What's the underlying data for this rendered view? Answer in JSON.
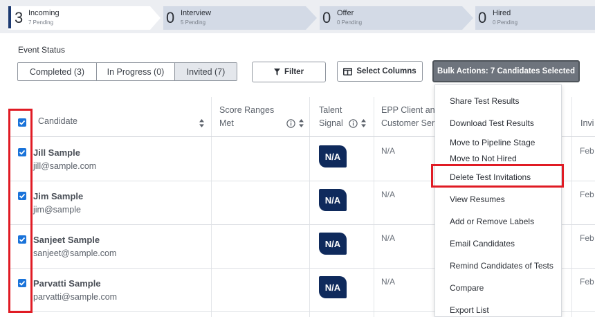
{
  "pipeline": {
    "stages": [
      {
        "count": "3",
        "title": "Incoming",
        "sub": "7 Pending"
      },
      {
        "count": "0",
        "title": "Interview",
        "sub": "5 Pending"
      },
      {
        "count": "0",
        "title": "Offer",
        "sub": "0 Pending"
      },
      {
        "count": "0",
        "title": "Hired",
        "sub": "0 Pending"
      }
    ]
  },
  "event_status": {
    "label": "Event Status",
    "tabs": [
      {
        "label": "Completed (3)"
      },
      {
        "label": "In Progress (0)"
      },
      {
        "label": "Invited (7)"
      }
    ]
  },
  "toolbar": {
    "filter_label": "Filter",
    "select_columns_label": "Select Columns",
    "bulk_actions_label": "Bulk Actions: 7 Candidates Selected"
  },
  "table": {
    "headers": {
      "candidate": "Candidate",
      "score_ranges_line1": "Score Ranges",
      "score_ranges_line2": "Met",
      "talent_line1": "Talent",
      "talent_line2": "Signal",
      "epp_line1": "EPP Client and",
      "epp_line2": "Customer Ser",
      "invited": "Invi"
    },
    "rows": [
      {
        "name": "Jill Sample",
        "email": "jill@sample.com",
        "talent": "N/A",
        "epp": "N/A",
        "date": "Feb"
      },
      {
        "name": "Jim Sample",
        "email": "jim@sample",
        "talent": "N/A",
        "epp": "N/A",
        "date": "Feb"
      },
      {
        "name": "Sanjeet Sample",
        "email": "sanjeet@sample.com",
        "talent": "N/A",
        "epp": "N/A",
        "date": "Feb"
      },
      {
        "name": "Parvatti Sample",
        "email": "parvatti@sample.com",
        "talent": "N/A",
        "epp": "N/A",
        "date": "Feb"
      }
    ]
  },
  "bulk_menu": {
    "items": [
      {
        "label": "Share Test Results"
      },
      {
        "label": "Download Test Results"
      },
      {
        "label": "Move to Pipeline Stage"
      },
      {
        "label": "Move to Not Hired"
      },
      {
        "label": "Delete Test Invitations"
      },
      {
        "label": "View Resumes"
      },
      {
        "label": "Add or Remove Labels"
      },
      {
        "label": "Email Candidates"
      },
      {
        "label": "Remind Candidates of Tests"
      },
      {
        "label": "Compare"
      },
      {
        "label": "Export List"
      }
    ]
  },
  "colors": {
    "accent_blue": "#1a73d9",
    "navy_badge": "#0f2a5c",
    "highlight_red": "#e01b24",
    "bulk_button": "#6e747d"
  }
}
